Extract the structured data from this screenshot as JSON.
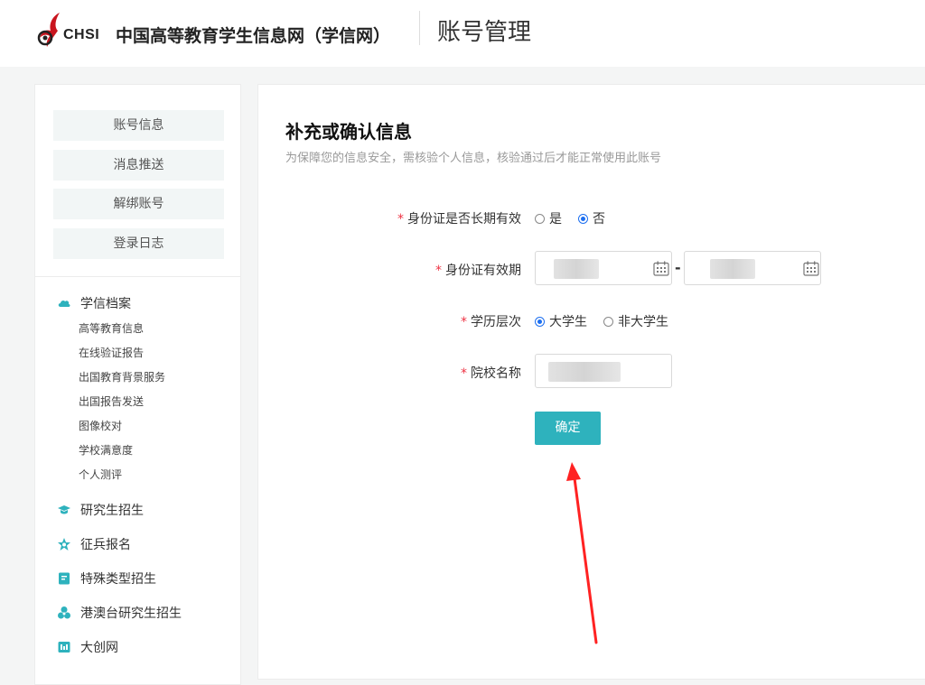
{
  "header": {
    "logo_text": "CHSI",
    "site_name": "中国高等教育学生信息网（学信网）",
    "page_name": "账号管理"
  },
  "sidebar": {
    "buttons": [
      "账号信息",
      "消息推送",
      "解绑账号",
      "登录日志"
    ],
    "groups": [
      {
        "label": "学信档案",
        "icon": "cloud-icon",
        "items": [
          "高等教育信息",
          "在线验证报告",
          "出国教育背景服务",
          "出国报告发送",
          "图像校对",
          "学校满意度",
          "个人测评"
        ]
      },
      {
        "label": "研究生招生",
        "icon": "graduation-cap-icon"
      },
      {
        "label": "征兵报名",
        "icon": "star-icon"
      },
      {
        "label": "特殊类型招生",
        "icon": "book-icon"
      },
      {
        "label": "港澳台研究生招生",
        "icon": "circles-icon"
      },
      {
        "label": "大创网",
        "icon": "chart-box-icon"
      }
    ]
  },
  "form": {
    "title": "补充或确认信息",
    "subtitle": "为保障您的信息安全，需核验个人信息，核验通过后才能正常使用此账号",
    "required_mark": "*",
    "long_term": {
      "label": "身份证是否长期有效",
      "options": [
        "是",
        "否"
      ],
      "selected": "否"
    },
    "validity": {
      "label": "身份证有效期",
      "separator": "-"
    },
    "education": {
      "label": "学历层次",
      "options": [
        "大学生",
        "非大学生"
      ],
      "selected": "大学生"
    },
    "school": {
      "label": "院校名称"
    },
    "submit_label": "确定"
  },
  "colors": {
    "accent": "#2eb2bd",
    "radio_selected": "#1d6ff0",
    "required": "#ee3344",
    "annotation_arrow": "#ff2222"
  }
}
